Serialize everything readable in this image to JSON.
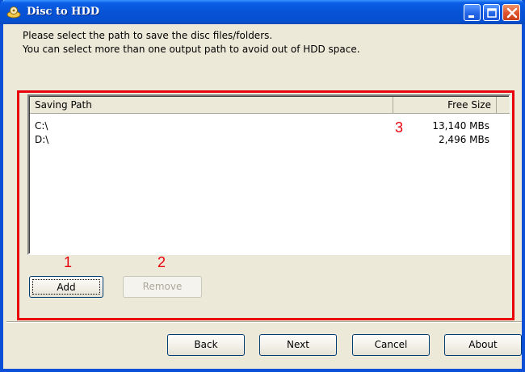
{
  "window": {
    "title": "Disc to HDD",
    "controls": [
      "minimize-icon",
      "maximize-icon",
      "close-icon"
    ]
  },
  "instructions": {
    "line1": "Please select the path to save the disc files/folders.",
    "line2": "You can select more than one output path to avoid out of HDD space."
  },
  "list": {
    "columns": [
      "Saving Path",
      "Free Size"
    ],
    "rows": [
      {
        "path": "C:\\",
        "free": "13,140 MBs"
      },
      {
        "path": "D:\\",
        "free": "2,496 MBs"
      }
    ]
  },
  "buttons": {
    "add": "Add",
    "remove": "Remove",
    "back": "Back",
    "next": "Next",
    "cancel": "Cancel",
    "about": "About"
  },
  "annotations": {
    "m1": "1",
    "m2": "2",
    "m3": "3"
  },
  "colors": {
    "title_bar": "#0753d6",
    "annotation_red": "#e8000d",
    "dialog_bg": "#ece9d8"
  }
}
